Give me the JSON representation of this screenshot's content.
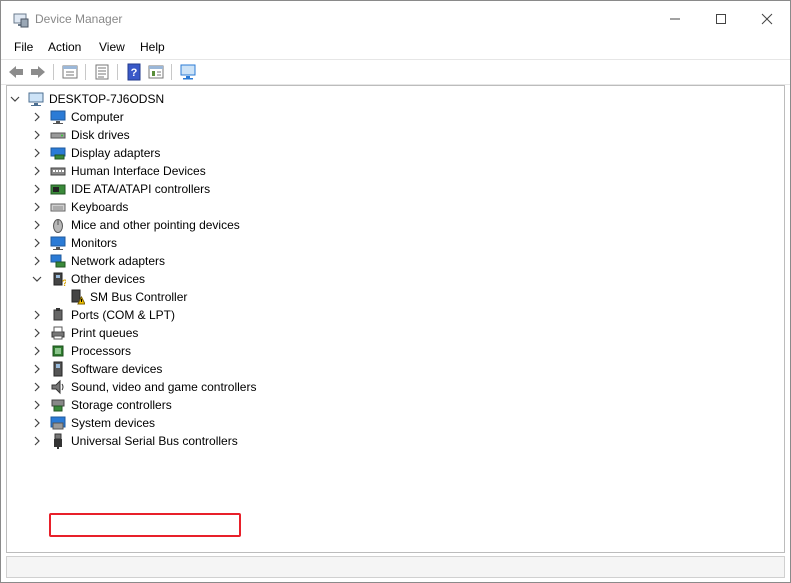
{
  "window": {
    "title": "Device Manager",
    "controls": {
      "minimize": "minimize",
      "maximize": "maximize",
      "close": "close"
    }
  },
  "menu": {
    "items": [
      "File",
      "Action",
      "View",
      "Help"
    ]
  },
  "toolbar": {
    "buttons": [
      "back-icon",
      "forward-icon",
      "properties-view-icon",
      "list-icon",
      "help-icon",
      "details-icon",
      "scan-hardware-icon"
    ]
  },
  "tree": {
    "root": "DESKTOP-7J6ODSN",
    "categories": [
      "Computer",
      "Disk drives",
      "Display adapters",
      "Human Interface Devices",
      "IDE ATA/ATAPI controllers",
      "Keyboards",
      "Mice and other pointing devices",
      "Monitors",
      "Network adapters",
      "Other devices",
      "Ports (COM & LPT)",
      "Print queues",
      "Processors",
      "Software devices",
      "Sound, video and game controllers",
      "Storage controllers",
      "System devices",
      "Universal Serial Bus controllers"
    ],
    "other_devices_child": "SM Bus Controller",
    "highlighted": "Universal Serial Bus controllers"
  },
  "colors": {
    "highlight": "#e8202a",
    "icon_blue": "#2b7bd6"
  }
}
